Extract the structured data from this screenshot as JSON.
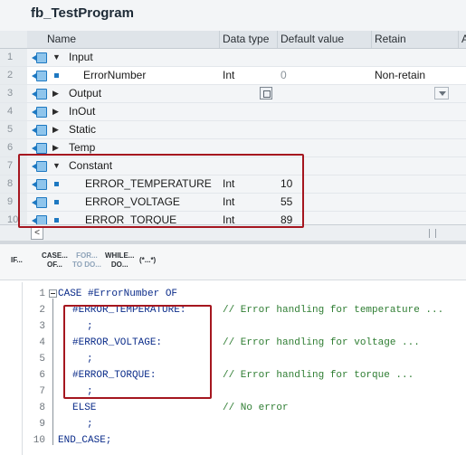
{
  "block": {
    "title": "fb_TestProgram"
  },
  "table": {
    "headers": {
      "name": "Name",
      "data_type": "Data type",
      "default_value": "Default value",
      "retain": "Retain",
      "extra": "Ac"
    },
    "rows": [
      {
        "num": "1",
        "expander": "▼",
        "kind": "section",
        "name": "Input",
        "data_type": "",
        "default_value": "",
        "retain": ""
      },
      {
        "num": "2",
        "expander": "",
        "kind": "member",
        "name": "ErrorNumber",
        "data_type": "Int",
        "default_value": "0",
        "retain": "Non-retain"
      },
      {
        "num": "3",
        "expander": "▶",
        "kind": "section",
        "name": "Output",
        "data_type": "",
        "default_value": "",
        "retain": ""
      },
      {
        "num": "4",
        "expander": "▶",
        "kind": "section",
        "name": "InOut",
        "data_type": "",
        "default_value": "",
        "retain": ""
      },
      {
        "num": "5",
        "expander": "▶",
        "kind": "section",
        "name": "Static",
        "data_type": "",
        "default_value": "",
        "retain": ""
      },
      {
        "num": "6",
        "expander": "▶",
        "kind": "section",
        "name": "Temp",
        "data_type": "",
        "default_value": "",
        "retain": ""
      },
      {
        "num": "7",
        "expander": "▼",
        "kind": "section",
        "name": "Constant",
        "data_type": "",
        "default_value": "",
        "retain": ""
      },
      {
        "num": "8",
        "expander": "",
        "kind": "member",
        "name": "ERROR_TEMPERATURE",
        "data_type": "Int",
        "default_value": "10",
        "retain": ""
      },
      {
        "num": "9",
        "expander": "",
        "kind": "member",
        "name": "ERROR_VOLTAGE",
        "data_type": "Int",
        "default_value": "55",
        "retain": ""
      },
      {
        "num": "10",
        "expander": "",
        "kind": "member",
        "name": "ERROR_TORQUE",
        "data_type": "Int",
        "default_value": "89",
        "retain": ""
      }
    ],
    "scroll_left": "<"
  },
  "toolbar": {
    "if": "IF...",
    "case_top": "CASE...",
    "case_bot": "OF...",
    "for_top": "FOR...",
    "for_bot": "TO DO...",
    "while_top": "WHILE...",
    "while_bot": "DO...",
    "comment": "(*...*)"
  },
  "code": {
    "lines": [
      {
        "n": "1",
        "text": "CASE #ErrorNumber OF",
        "comment": ""
      },
      {
        "n": "2",
        "text": "#ERROR_TEMPERATURE:",
        "comment": "// Error handling for temperature ..."
      },
      {
        "n": "3",
        "text": ";",
        "comment": ""
      },
      {
        "n": "4",
        "text": "#ERROR_VOLTAGE:",
        "comment": "// Error handling for voltage ..."
      },
      {
        "n": "5",
        "text": ";",
        "comment": ""
      },
      {
        "n": "6",
        "text": "#ERROR_TORQUE:",
        "comment": "// Error handling for torque ..."
      },
      {
        "n": "7",
        "text": ";",
        "comment": ""
      },
      {
        "n": "8",
        "text": "ELSE",
        "comment": "// No error"
      },
      {
        "n": "9",
        "text": ";",
        "comment": ""
      },
      {
        "n": "10",
        "text": "END_CASE;",
        "comment": ""
      }
    ]
  },
  "colors": {
    "highlight": "#a5161f",
    "keyword": "#0b2c8a",
    "comment": "#2e7d32",
    "icon": "#1d78c1"
  }
}
